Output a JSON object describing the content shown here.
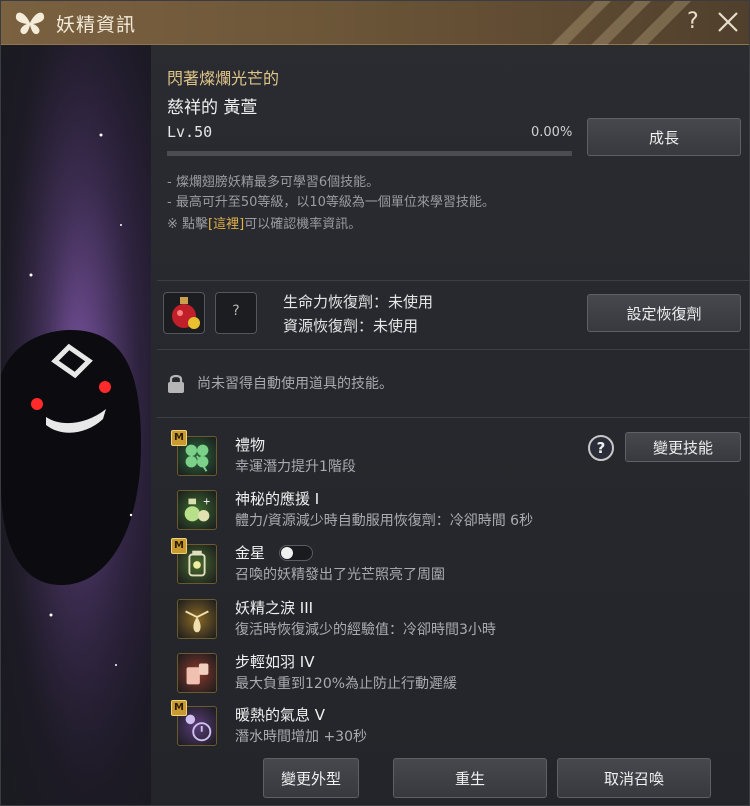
{
  "window": {
    "title": "妖精資訊",
    "help_label": "?"
  },
  "fairy": {
    "subtitle": "閃著燦爛光芒的",
    "name": "慈祥的 黃萱",
    "level": "Lv.50",
    "growth_percent": "0.00%",
    "growth_fraction": 0.0
  },
  "buttons": {
    "grow": "成長",
    "set_recovery": "設定恢復劑",
    "change_skill": "變更技能",
    "change_appearance": "變更外型",
    "rebirth": "重生",
    "cancel_summon": "取消召喚"
  },
  "info": {
    "line1": "- 燦爛翅膀妖精最多可學習6個技能。",
    "line2": "- 最高可升至50等級，以10等級為一個單位來學習技能。",
    "line3_prefix": "※ 點擊",
    "line3_link": "[這裡]",
    "line3_suffix": "可以確認機率資訊。"
  },
  "recovery": {
    "slot2_label": "?",
    "hp_text": "生命力恢復劑：未使用",
    "resource_text": "資源恢復劑：未使用"
  },
  "auto_use": {
    "locked_text": "尚未習得自動使用道具的技能。"
  },
  "skills": [
    {
      "name": "禮物",
      "desc": "幸運潛力提升1階段",
      "badge": "M",
      "icon": "clover-icon",
      "color": "#2d6b3a"
    },
    {
      "name": "神秘的應援 I",
      "desc": "體力/資源減少時自動服用恢復劑：冷卻時間 6秒",
      "badge": "",
      "icon": "potion-support-icon",
      "color": "#3d6b2d"
    },
    {
      "name": "金星",
      "desc": "召喚的妖精發出了光芒照亮了周圍",
      "badge": "M",
      "icon": "lantern-icon",
      "color": "#4a6b2d",
      "toggle": true
    },
    {
      "name": "妖精之淚 III",
      "desc": "復活時恢復減少的經驗值：冷卻時間3小時",
      "badge": "",
      "icon": "tear-icon",
      "color": "#8a6a25"
    },
    {
      "name": "步輕如羽 IV",
      "desc": "最大負重到120%為止防止行動遲緩",
      "badge": "",
      "icon": "weight-icon",
      "color": "#8a3a2a"
    },
    {
      "name": "暖熱的氣息 V",
      "desc": "潛水時間增加 +30秒",
      "badge": "M",
      "icon": "bubble-icon",
      "color": "#5a3d7a"
    }
  ],
  "colors": {
    "accent_gold": "#e0c58a",
    "link_gold": "#e3b24a",
    "title_bar": "#6e5739"
  }
}
